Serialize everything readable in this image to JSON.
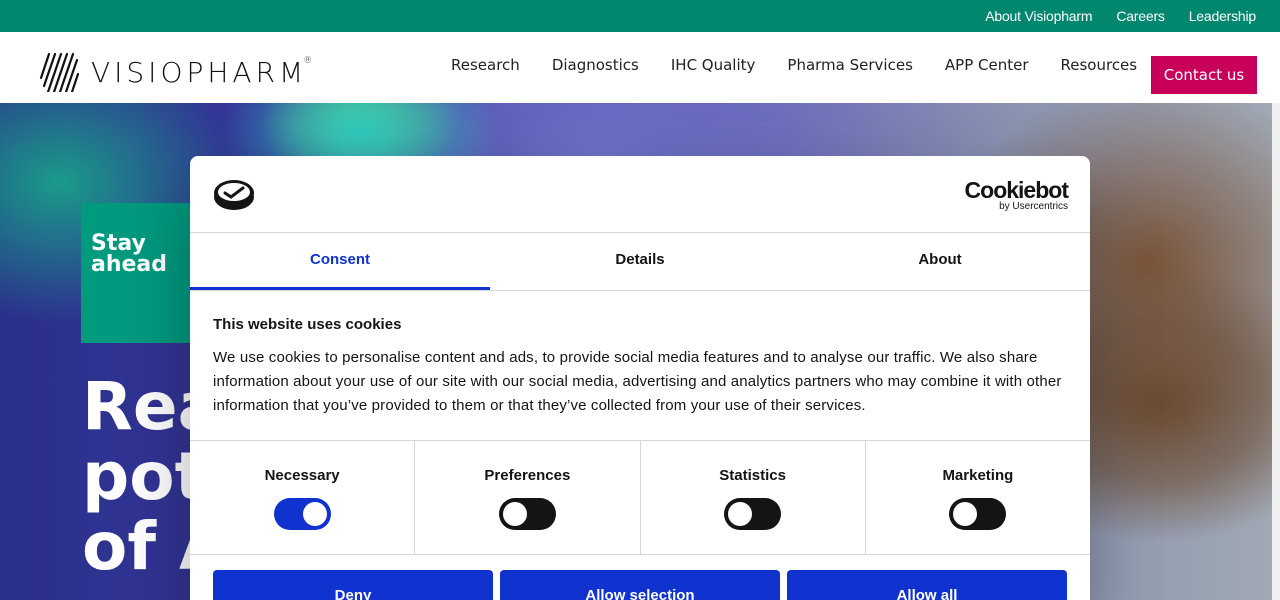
{
  "topbar": {
    "links": [
      "About Visiopharm",
      "Careers",
      "Leadership"
    ]
  },
  "nav": {
    "logo_text": "VISIOPHARM",
    "logo_reg": "®",
    "items": [
      "Research",
      "Diagnostics",
      "IHC Quality",
      "Pharma Services",
      "APP Center",
      "Resources"
    ],
    "contact_label": "Contact us"
  },
  "hero": {
    "badge_line1": "Stay",
    "badge_line2": "ahead",
    "headline_line1": "Rea",
    "headline_line2": "pot",
    "headline_line3": "of A"
  },
  "dialog": {
    "brand_name": "Cookiebot",
    "brand_sub": "by Usercentrics",
    "tabs": [
      "Consent",
      "Details",
      "About"
    ],
    "active_tab": "Consent",
    "heading": "This website uses cookies",
    "text": "We use cookies to personalise content and ads, to provide social media features and to analyse our traffic. We also share information about your use of our site with our social media, advertising and analytics partners who may combine it with other information that you’ve provided to them or that they’ve collected from your use of their services.",
    "categories": [
      {
        "label": "Necessary",
        "on": true
      },
      {
        "label": "Preferences",
        "on": false
      },
      {
        "label": "Statistics",
        "on": false
      },
      {
        "label": "Marketing",
        "on": false
      }
    ],
    "buttons": [
      "Deny",
      "Allow selection",
      "Allow all"
    ]
  },
  "colors": {
    "topbar": "#00876e",
    "contact": "#c8005a",
    "accent": "#1032cf",
    "badge": "#009a7f"
  }
}
